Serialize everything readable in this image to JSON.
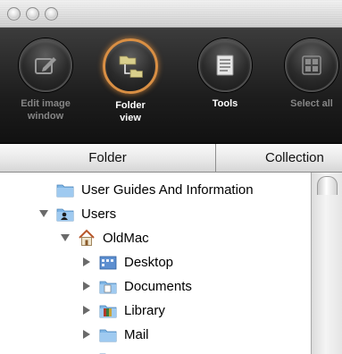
{
  "toolbar": {
    "tools": [
      {
        "label_line1": "Edit image",
        "label_line2": "window",
        "icon": "edit-image-icon",
        "active": false
      },
      {
        "label_line1": "Folder",
        "label_line2": "view",
        "icon": "folder-view-icon",
        "active": true
      },
      {
        "label_line1": "Tools",
        "label_line2": "",
        "icon": "tools-icon",
        "active": false
      },
      {
        "label_line1": "Select all",
        "label_line2": "",
        "icon": "select-all-icon",
        "active": false
      }
    ],
    "accent_color": "#d98f44"
  },
  "columns": {
    "folder": "Folder",
    "collection": "Collection"
  },
  "tree": {
    "user_guides": "User Guides And Information",
    "users": "Users",
    "oldmac": "OldMac",
    "desktop": "Desktop",
    "documents": "Documents",
    "library": "Library",
    "mail": "Mail"
  }
}
